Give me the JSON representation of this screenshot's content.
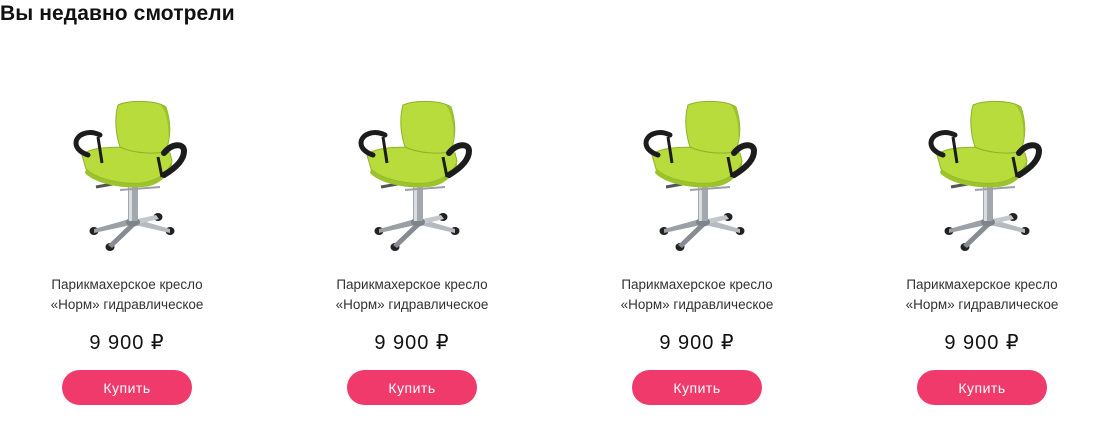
{
  "section": {
    "title": "Вы недавно смотрели"
  },
  "colors": {
    "buy_button": "#f03a6c",
    "seat": "#b7dc3c",
    "arms": "#1c1c1c",
    "chrome": "#9aa0a6"
  },
  "products": [
    {
      "name_line1": "Парикмахерское кресло",
      "name_line2": "«Норм» гидравлическое",
      "price": "9 900 ₽",
      "buy_label": "Купить",
      "image_icon": "barber-chair-icon"
    },
    {
      "name_line1": "Парикмахерское кресло",
      "name_line2": "«Норм» гидравлическое",
      "price": "9 900 ₽",
      "buy_label": "Купить",
      "image_icon": "barber-chair-icon"
    },
    {
      "name_line1": "Парикмахерское кресло",
      "name_line2": "«Норм» гидравлическое",
      "price": "9 900 ₽",
      "buy_label": "Купить",
      "image_icon": "barber-chair-icon"
    },
    {
      "name_line1": "Парикмахерское кресло",
      "name_line2": "«Норм» гидравлическое",
      "price": "9 900 ₽",
      "buy_label": "Купить",
      "image_icon": "barber-chair-icon"
    }
  ]
}
